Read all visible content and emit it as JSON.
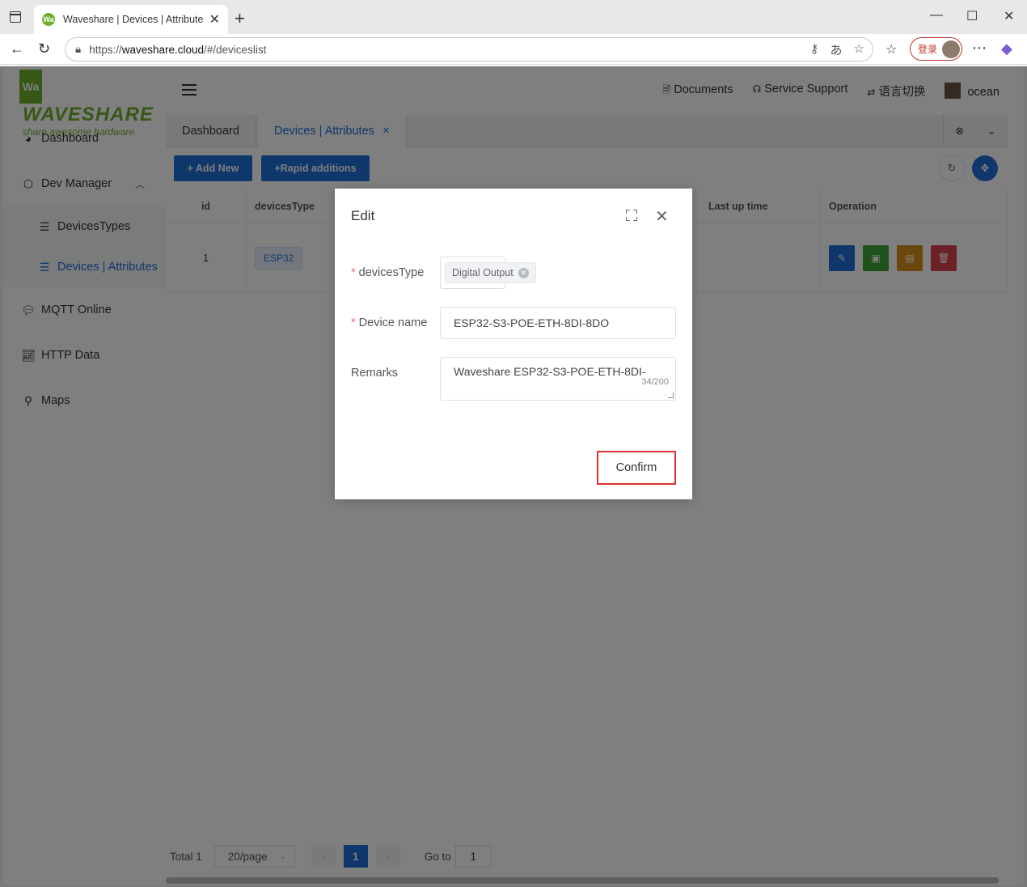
{
  "browser": {
    "tab_title": "Waveshare | Devices | Attributes",
    "favicon_text": "Wa",
    "url_prefix": "https://",
    "url_host": "waveshare.cloud",
    "url_path": "/#/deviceslist",
    "login_label": "登录"
  },
  "logo": {
    "mark": "Wa",
    "brand": "WAVESHARE",
    "tagline": "share awesome hardware"
  },
  "sidebar": {
    "items": [
      {
        "label": "Dashboard",
        "icon": "pie-chart-icon"
      },
      {
        "label": "Dev Manager",
        "icon": "box-icon"
      },
      {
        "label": "DevicesTypes",
        "icon": "list-icon"
      },
      {
        "label": "Devices | Attributes",
        "icon": "list-icon"
      },
      {
        "label": "MQTT Online",
        "icon": "chat-icon"
      },
      {
        "label": "HTTP Data",
        "icon": "line-chart-icon"
      },
      {
        "label": "Maps",
        "icon": "location-icon"
      }
    ]
  },
  "header": {
    "documents": "Documents",
    "support": "Service Support",
    "language": "语言切换",
    "user": "ocean"
  },
  "tabs": {
    "dashboard": "Dashboard",
    "devices": "Devices | Attributes"
  },
  "toolbar": {
    "add_new": "+ Add New",
    "rapid": "+Rapid additions"
  },
  "table": {
    "headers": [
      "id",
      "devicesType",
      "Last up time",
      "Operation"
    ],
    "row": {
      "id": "1",
      "type": "ESP32"
    },
    "op_colors": [
      "#1e6fd9",
      "#3fa338",
      "#d68f1c",
      "#d9434a"
    ]
  },
  "pagination": {
    "total": "Total 1",
    "page_size": "20/page",
    "current": "1",
    "goto_label": "Go to",
    "goto_value": "1"
  },
  "dialog": {
    "title": "Edit",
    "devices_type_label": "devicesType",
    "devices_type_value": "Digital Output",
    "device_name_label": "Device name",
    "device_name_value": "ESP32-S3-POE-ETH-8DI-8DO",
    "remarks_label": "Remarks",
    "remarks_value": "Waveshare ESP32-S3-POE-ETH-8DI-",
    "remarks_count": "34/200",
    "confirm": "Confirm"
  }
}
